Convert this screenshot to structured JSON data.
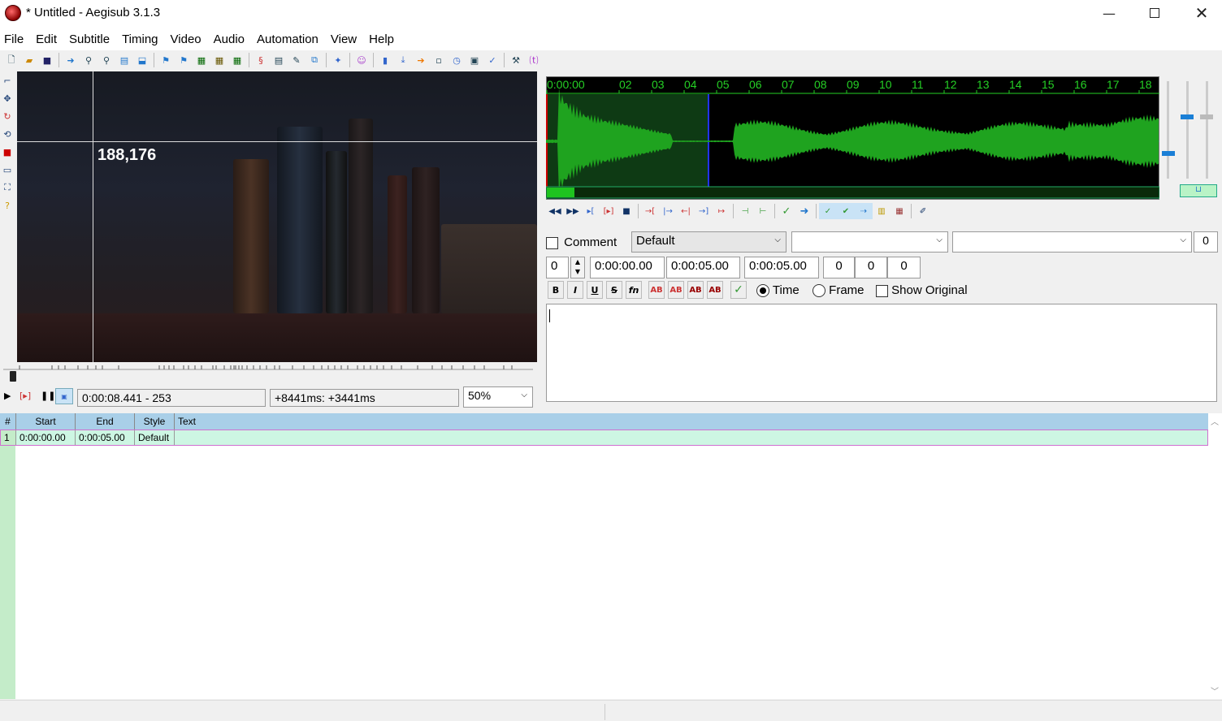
{
  "window": {
    "title": "* Untitled - Aegisub 3.1.3",
    "minimize_icon": "minimize-icon",
    "maximize_icon": "maximize-icon",
    "close_icon": "close-icon"
  },
  "menu": [
    "File",
    "Edit",
    "Subtitle",
    "Timing",
    "Video",
    "Audio",
    "Automation",
    "View",
    "Help"
  ],
  "video": {
    "coordinates": "188,176",
    "time_display": "0:00:08.441 - 253",
    "offset_display": "+8441ms: +3441ms",
    "zoom": "50%"
  },
  "audio": {
    "timeline_labels": [
      "0:00:00",
      "02",
      "03",
      "04",
      "05",
      "06",
      "07",
      "08",
      "09",
      "10",
      "11",
      "12",
      "13",
      "14",
      "15",
      "16",
      "17",
      "18"
    ],
    "waveform_color": "#1fa31f",
    "selection_color": "#0e3a14"
  },
  "edit": {
    "comment_label": "Comment",
    "style_value": "Default",
    "actor_value": "",
    "effect_value": "",
    "margin_value": "0",
    "layer_value": "0",
    "start_time": "0:00:00.00",
    "end_time": "0:00:05.00",
    "duration": "0:00:05.00",
    "margin_l": "0",
    "margin_r": "0",
    "margin_v": "0",
    "bold": "B",
    "italic": "I",
    "underline": "U",
    "strike": "S",
    "font": "fn",
    "color1": "AB",
    "color2": "AB",
    "color3": "AB",
    "color4": "AB",
    "time_label": "Time",
    "frame_label": "Frame",
    "show_original_label": "Show Original",
    "text_value": ""
  },
  "grid": {
    "headers": [
      "#",
      "Start",
      "End",
      "Style",
      "Text"
    ],
    "rows": [
      {
        "num": "1",
        "start": "0:00:00.00",
        "end": "0:00:05.00",
        "style": "Default",
        "text": ""
      }
    ]
  },
  "colors": {
    "grid_header": "#a9cfe8",
    "grid_row": "#cdf6e3",
    "grid_row_border": "#d070d0"
  }
}
